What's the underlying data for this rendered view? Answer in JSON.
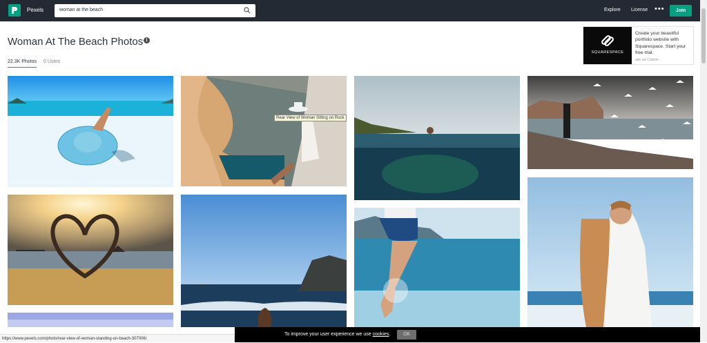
{
  "header": {
    "brand": "Pexels",
    "search_value": "woman at the beach",
    "nav": {
      "explore": "Explore",
      "license": "License",
      "more": "•••",
      "join": "Join"
    }
  },
  "page": {
    "title": "Woman At The Beach Photos",
    "info_icon": "i",
    "tabs": [
      {
        "label": "22.3K Photos",
        "active": true
      },
      {
        "label": "0 Users",
        "active": false
      }
    ]
  },
  "ad": {
    "logo_text": "SQUARESPACE",
    "text": "Create your beautiful portfolio website with Squarespace. Start your free trial.",
    "via": "ads via Carbon"
  },
  "photos": [
    {
      "name": "photo-woman-lying-hat",
      "col": 0
    },
    {
      "name": "photo-woman-sitting-rock",
      "col": 1,
      "tooltip": "Rear View of Woman Sitting on Rock"
    },
    {
      "name": "photo-swimmer-horizon",
      "col": 2
    },
    {
      "name": "photo-man-seagulls",
      "col": 3
    },
    {
      "name": "photo-heart-silhouette",
      "col": 0
    },
    {
      "name": "photo-sea-cliff",
      "col": 1
    },
    {
      "name": "photo-legs-splash",
      "col": 2
    },
    {
      "name": "photo-couple-embrace",
      "col": 3
    }
  ],
  "status_url": "https://www.pexels.com/photo/rear-view-of-woman-standing-on-beach-307006/",
  "cookie": {
    "text": "To improve your user experience we use",
    "link": "cookies",
    "suffix": ".",
    "ok": "OK"
  },
  "colors": {
    "accent": "#05a081",
    "topbar": "#232a34"
  }
}
